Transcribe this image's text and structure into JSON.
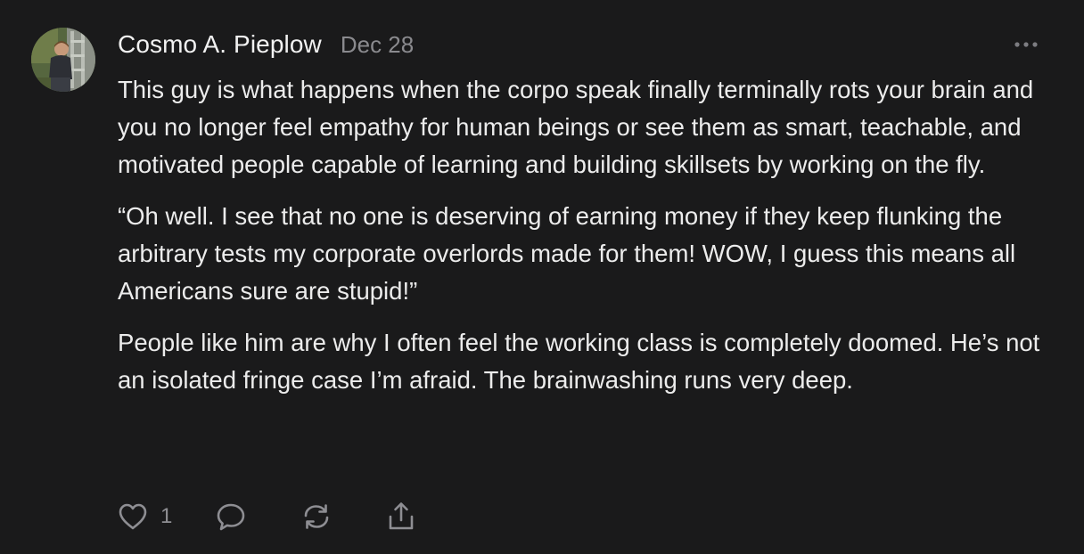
{
  "post": {
    "author": "Cosmo A. Pieplow",
    "date": "Dec 28",
    "paragraphs": [
      "This guy is what happens when the corpo speak finally terminally rots your brain and you no longer feel empathy for human beings or see them as smart, teachable, and motivated people capable of learning and building skillsets by working on the fly.",
      "“Oh well. I see that no one is deserving of earning money if they keep flunking the arbitrary tests my corporate overlords made for them! WOW, I guess this means all Americans sure are stupid!”",
      "People like him are why I often feel the working class is completely doomed. He’s not an isolated fringe case I’m afraid. The brainwashing runs very deep."
    ],
    "likes": "1"
  },
  "icons": {
    "more": "more-horizontal-icon",
    "like": "heart-icon",
    "comment": "comment-bubble-icon",
    "restack": "restack-icon",
    "share": "share-icon"
  },
  "colors": {
    "background": "#1a1a1b",
    "text": "#ececec",
    "muted": "#8a8a8e"
  }
}
